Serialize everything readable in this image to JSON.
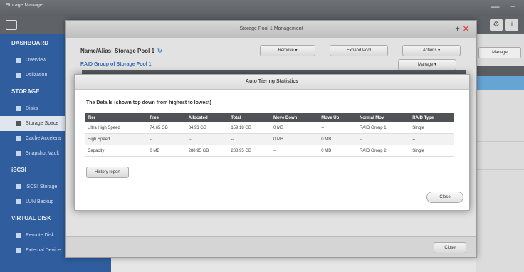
{
  "app": {
    "title": "Storage Manager"
  },
  "sidebar": {
    "sections": [
      {
        "title": "DASHBOARD",
        "items": [
          "Overview",
          "Utilization"
        ]
      },
      {
        "title": "STORAGE",
        "items": [
          "Disks",
          "Storage Space",
          "Cache Accelera",
          "Snapshot Vault"
        ]
      },
      {
        "title": "iSCSI",
        "items": [
          "iSCSI Storage",
          "LUN Backup"
        ]
      },
      {
        "title": "VIRTUAL DISK",
        "items": [
          "Remote Disk",
          "External Device"
        ]
      }
    ],
    "active": "Storage Space"
  },
  "right_pane": {
    "manage_label": "Manage"
  },
  "pool_window": {
    "title": "Storage Pool 1 Management",
    "name_label": "Name/Alias: Storage Pool 1",
    "remove_label": "Remove",
    "expand_label": "Expand Pool",
    "actions_label": "Actions",
    "raid_group_label": "RAID Group of Storage Pool 1",
    "manage_label": "Manage",
    "close_label": "Close"
  },
  "dialog": {
    "title": "Auto Tiering Statistics",
    "details_label": "The Details (shown top down from highest to lowest)",
    "columns": [
      "Tier",
      "Free",
      "Allocated",
      "Total",
      "Move Down",
      "Move Up",
      "Normal Mov",
      "RAID Type"
    ],
    "rows": [
      [
        "Ultra High Speed",
        "74.65 GB",
        "84.93 GB",
        "159.18 GB",
        "0 MB",
        "--",
        "RAID Group 1",
        "Single"
      ],
      [
        "High Speed",
        "--",
        "--",
        "--",
        "0 MB",
        "0 MB",
        "--",
        "--"
      ],
      [
        "Capacity",
        "0 MB",
        "288.95 GB",
        "288.95 GB",
        "--",
        "0 MB",
        "RAID Group 2",
        "Single"
      ]
    ],
    "history_label": "History report",
    "close_label": "Close"
  }
}
